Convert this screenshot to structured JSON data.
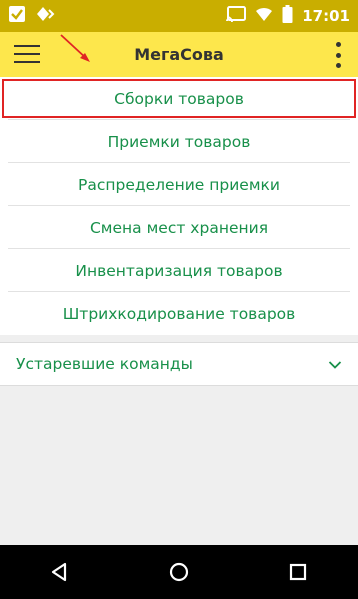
{
  "status_bar": {
    "time": "17:01",
    "left_icons": [
      "check-notification-icon",
      "diamond-notification-icon"
    ],
    "right_icons": [
      "cast-icon",
      "wifi-icon",
      "battery-icon"
    ]
  },
  "app_bar": {
    "title": "МегаСова",
    "menu_icon": "hamburger-icon",
    "more_icon": "kebab-icon"
  },
  "menu": {
    "items": [
      {
        "label": "Сборки товаров",
        "highlighted": true
      },
      {
        "label": "Приемки товаров"
      },
      {
        "label": "Распределение приемки"
      },
      {
        "label": "Смена мест хранения"
      },
      {
        "label": "Инвентаризация товаров"
      },
      {
        "label": "Штрихкодирование товаров"
      }
    ]
  },
  "section": {
    "label": "Устаревшие команды",
    "icon": "chevron-down-icon"
  },
  "colors": {
    "status_bar": "#c9ae00",
    "app_bar": "#fde74c",
    "menu_text": "#18904a",
    "highlight_border": "#e02424",
    "annotation_arrow": "#e02424"
  },
  "nav_bar": {
    "icons": [
      "back-icon",
      "home-icon",
      "recents-icon"
    ]
  }
}
